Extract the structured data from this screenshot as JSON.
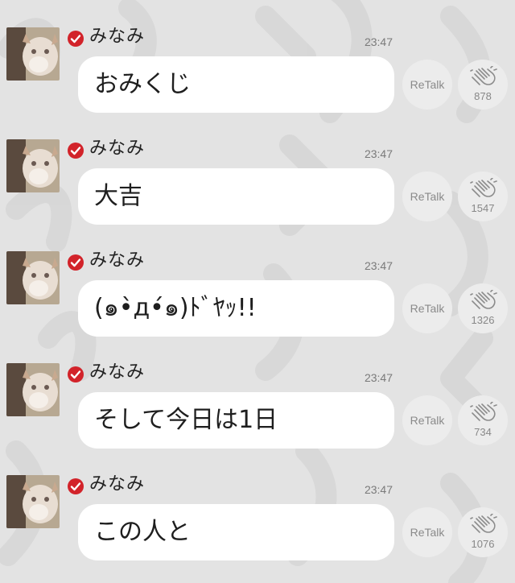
{
  "messages": [
    {
      "sender": "みなみ",
      "time": "23:47",
      "text": "おみくじ",
      "retalk_label": "ReTalk",
      "claps": "878"
    },
    {
      "sender": "みなみ",
      "time": "23:47",
      "text": "大吉",
      "retalk_label": "ReTalk",
      "claps": "1547"
    },
    {
      "sender": "みなみ",
      "time": "23:47",
      "text": "(๑•̀д•́๑)ﾄﾞﾔｯ!!",
      "retalk_label": "ReTalk",
      "claps": "1326"
    },
    {
      "sender": "みなみ",
      "time": "23:47",
      "text": "そして今日は1日",
      "retalk_label": "ReTalk",
      "claps": "734"
    },
    {
      "sender": "みなみ",
      "time": "23:47",
      "text": "この人と",
      "retalk_label": "ReTalk",
      "claps": "1076"
    }
  ],
  "icons": {
    "verified": "verified-check-icon",
    "clap": "clap-hands-icon",
    "avatar": "avatar-cat-photo"
  },
  "colors": {
    "background": "#e3e3e3",
    "bubble": "#ffffff",
    "verified_badge": "#d2232a",
    "action_button": "#ececec"
  }
}
